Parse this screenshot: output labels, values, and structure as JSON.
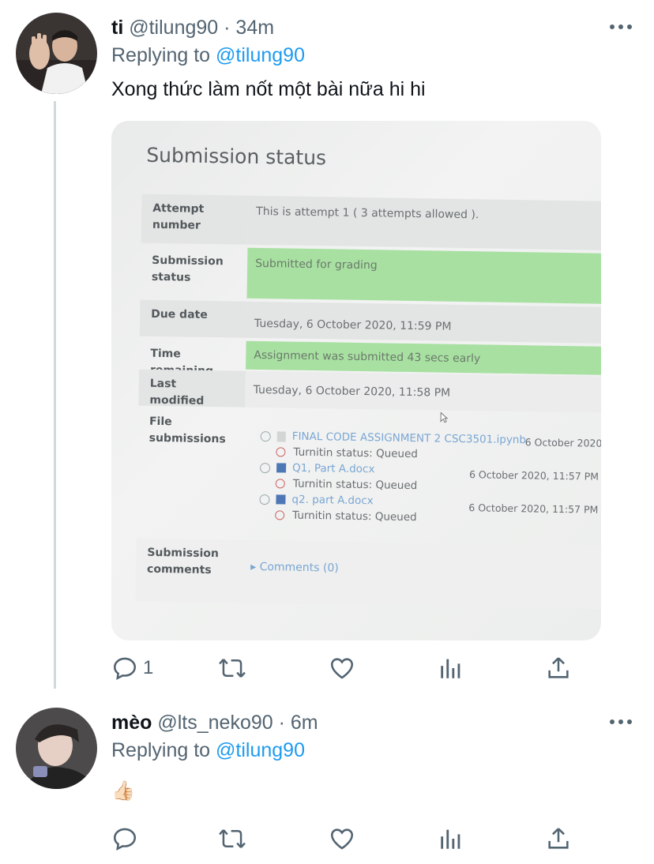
{
  "tweets": [
    {
      "name": "ti",
      "handle": "@tilung90",
      "separator": "·",
      "time": "34m",
      "replying_prefix": "Replying to",
      "replying_to": "@tilung90",
      "text": "Xong thức làm nốt một bài nữa hi hi",
      "reply_count": "1",
      "actions": [
        "reply-icon",
        "retweet-icon",
        "like-icon",
        "analytics-icon",
        "share-icon"
      ]
    },
    {
      "name": "mèo",
      "handle": "@lts_neko90",
      "separator": "·",
      "time": "6m",
      "replying_prefix": "Replying to",
      "replying_to": "@tilung90",
      "text": "👍🏻",
      "reply_count": "",
      "actions": [
        "reply-icon",
        "retweet-icon",
        "like-icon",
        "analytics-icon",
        "share-icon"
      ]
    }
  ],
  "photo": {
    "title": "Submission status",
    "rows": {
      "attempt_label": "Attempt number",
      "attempt_value": "This is attempt 1 ( 3 attempts allowed ).",
      "status_label": "Submission status",
      "status_value": "Submitted for grading",
      "due_label": "Due date",
      "due_value": "Tuesday, 6 October 2020, 11:59 PM",
      "remaining_label": "Time remaining",
      "remaining_value": "Assignment was submitted 43 secs early",
      "modified_label": "Last modified",
      "modified_value": "Tuesday, 6 October 2020, 11:58 PM",
      "files_label": "File submissions",
      "comments_label": "Submission comments",
      "comments_value": "Comments (0)"
    },
    "files": [
      {
        "name": "FINAL CODE ASSIGNMENT 2 CSC3501.ipynb",
        "date": "6 October 2020",
        "turnitin": "Turnitin status: Queued"
      },
      {
        "name": "Q1, Part A.docx",
        "date": "6 October 2020, 11:57 PM",
        "turnitin": "Turnitin status: Queued"
      },
      {
        "name": "q2. part A.docx",
        "date": "6 October 2020, 11:57 PM",
        "turnitin": "Turnitin status: Queued"
      }
    ]
  },
  "colors": {
    "link": "#1d9bf0",
    "secondary_text": "#536471",
    "primary_text": "#0f1419",
    "submitted_green": "#a8e0a2"
  }
}
